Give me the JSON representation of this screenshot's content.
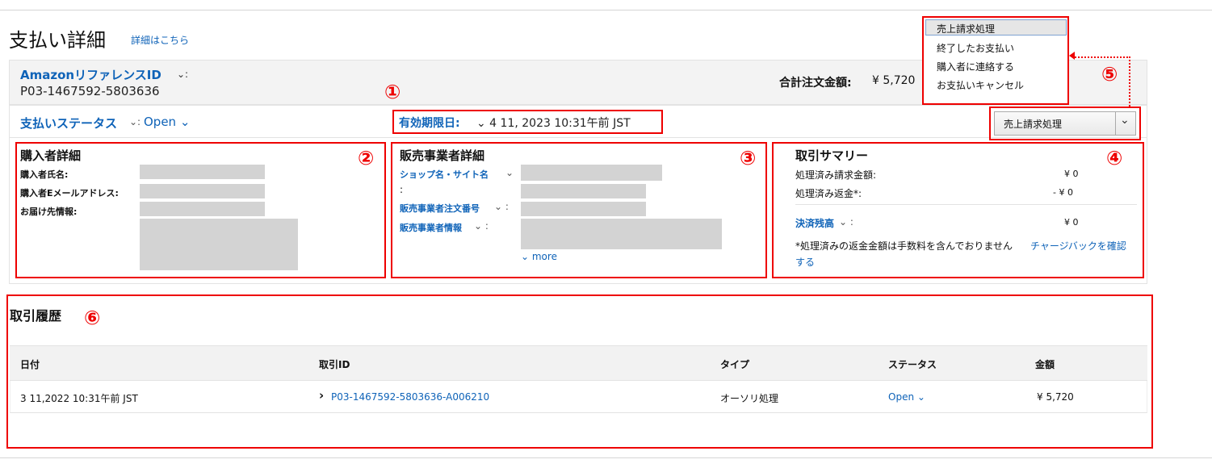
{
  "page": {
    "title": "支払い詳細",
    "title_link": "詳細はこちら"
  },
  "header": {
    "ref_label": "AmazonリファレンスID",
    "ref_suffix": "⌄:",
    "ref_value": "P03-1467592-5803636",
    "total_label": "合計注文金額:",
    "total_value": "¥ 5,720"
  },
  "status": {
    "label": "支払いステータス",
    "sep": "⌄:",
    "value": "Open ⌄"
  },
  "expiry": {
    "label": "有効期限日:",
    "value": "⌄ 4 11, 2023 10:31午前 JST"
  },
  "annotations": {
    "n1": "①",
    "n2": "②",
    "n3": "③",
    "n4": "④",
    "n5": "⑤",
    "n6": "⑥"
  },
  "buyer": {
    "title": "購入者詳細",
    "name_label": "購入者氏名:",
    "email_label": "購入者Eメールアドレス:",
    "address_label": "お届け先情報:"
  },
  "seller": {
    "title": "販売事業者詳細",
    "shop_label": "ショップ名・サイト名",
    "shop_suffix": "⌄",
    "shop_colon": ":",
    "order_label": "販売事業者注文番号",
    "order_suffix": "⌄ :",
    "info_label": "販売事業者情報",
    "info_suffix": "⌄ :",
    "more": "⌄ more"
  },
  "summary": {
    "title": "取引サマリー",
    "charged_label": "処理済み請求金額:",
    "charged_value": "¥ 0",
    "refund_label": "処理済み返金*:",
    "refund_value": "- ¥ 0",
    "balance_label": "決済残高",
    "balance_suffix": "⌄ :",
    "balance_value": "¥ 0",
    "note": "*処理済みの返金金額は手数料を含んでおりません",
    "note_link_1": "チャージバックを確認",
    "note_link_2": "する"
  },
  "action_select": {
    "selected": "売上請求処理",
    "arrow": "⌄"
  },
  "action_menu": {
    "items": [
      "売上請求処理",
      "終了したお支払い",
      "購入者に連絡する",
      "お支払いキャンセル"
    ]
  },
  "history": {
    "title": "取引履歴",
    "columns": [
      "日付",
      "取引ID",
      "タイプ",
      "ステータス",
      "金額"
    ],
    "rows": [
      {
        "date": "3 11,2022 10:31午前 JST",
        "arrow": "›",
        "id": "P03-1467592-5803636-A006210",
        "type": "オーソリ処理",
        "status": "Open ⌄",
        "amount": "¥ 5,720"
      }
    ]
  },
  "colors": {
    "link": "#0f63b8",
    "annotation": "#e00000",
    "redacted": "#d3d3d3"
  }
}
